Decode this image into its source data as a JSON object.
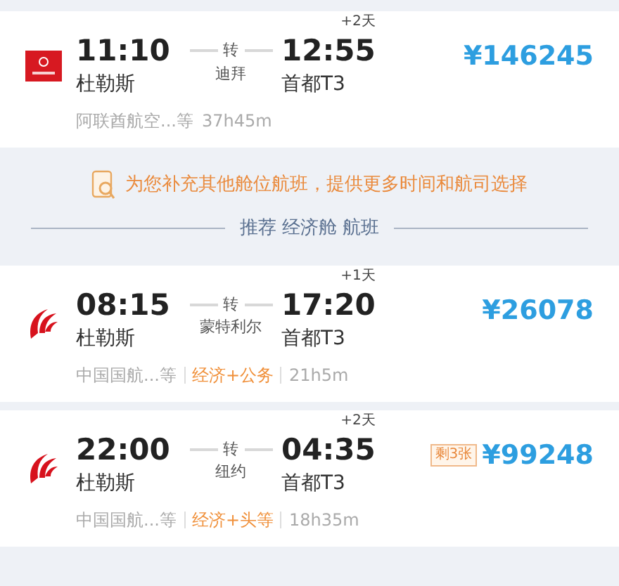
{
  "flights": [
    {
      "kind": "square",
      "depart_time": "11:10",
      "depart_airport": "杜勒斯",
      "transfer_label": "转",
      "transfer_city": "迪拜",
      "arrive_time": "12:55",
      "day_offset": "+2天",
      "arrive_airport": "首都T3",
      "price": "¥146245",
      "airline": "阿联酋航空...等",
      "duration": "37h45m"
    },
    {
      "kind": "swirl",
      "depart_time": "08:15",
      "depart_airport": "杜勒斯",
      "transfer_label": "转",
      "transfer_city": "蒙特利尔",
      "arrive_time": "17:20",
      "day_offset": "+1天",
      "arrive_airport": "首都T3",
      "price": "¥26078",
      "airline": "中国国航...等",
      "cabin": "经济+公务",
      "duration": "21h5m"
    },
    {
      "kind": "swirl",
      "depart_time": "22:00",
      "depart_airport": "杜勒斯",
      "transfer_label": "转",
      "transfer_city": "纽约",
      "arrive_time": "04:35",
      "day_offset": "+2天",
      "arrive_airport": "首都T3",
      "price": "¥99248",
      "seats_left": "剩3张",
      "airline": "中国国航...等",
      "cabin": "经济+头等",
      "duration": "18h35m"
    }
  ],
  "banner": {
    "text": "为您补充其他舱位航班，提供更多时间和航司选择",
    "section_title": "推荐 经济舱 航班"
  }
}
